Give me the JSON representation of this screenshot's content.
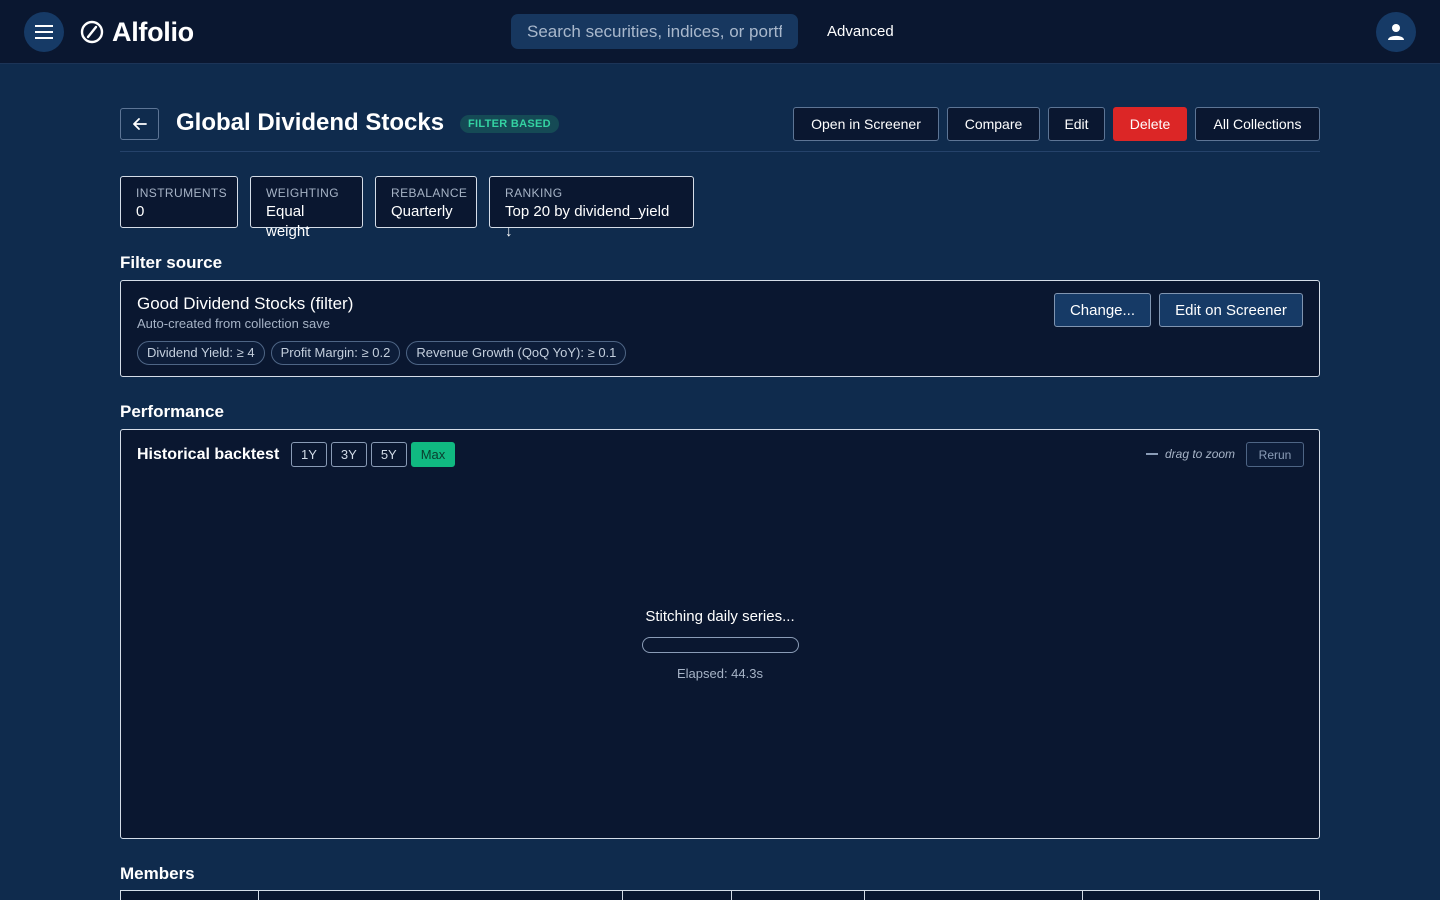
{
  "topbar": {
    "brand": "Alfolio",
    "search_placeholder": "Search securities, indices, or portfolios",
    "advanced_label": "Advanced",
    "icons": [
      "menu-icon",
      "compass-icon",
      "user-icon"
    ]
  },
  "header": {
    "title": "Global Dividend Stocks",
    "type_badge": "FILTER BASED",
    "buttons": {
      "open_in_screener": "Open in Screener",
      "compare": "Compare",
      "edit": "Edit",
      "delete": "Delete",
      "all_collections": "All Collections"
    }
  },
  "stats": [
    {
      "label": "INSTRUMENTS",
      "value": "0"
    },
    {
      "label": "WEIGHTING",
      "value": "Equal weight"
    },
    {
      "label": "REBALANCE",
      "value": "Quarterly"
    },
    {
      "label": "RANKING",
      "value": "Top 20 by dividend_yield ↓"
    }
  ],
  "filter_source": {
    "section_title": "Filter source",
    "name": "Good Dividend Stocks (filter)",
    "subtitle": "Auto-created from collection save",
    "chips": [
      "Dividend Yield: ≥ 4",
      "Profit Margin: ≥ 0.2",
      "Revenue Growth (QoQ YoY): ≥ 0.1"
    ],
    "change_button": "Change...",
    "edit_button": "Edit on Screener"
  },
  "performance": {
    "section_title": "Performance",
    "panel_title": "Historical backtest",
    "ranges": [
      "1Y",
      "3Y",
      "5Y",
      "Max"
    ],
    "active_range": "Max",
    "zoom_hint": "drag to zoom",
    "rerun_label": "Rerun",
    "loading_text": "Stitching daily series...",
    "progress_fraction": 0.0,
    "elapsed_text": "Elapsed: 44.3s"
  },
  "members": {
    "section_title": "Members"
  },
  "colors": {
    "background": "#0f2b4d",
    "topbar": "#0a1730",
    "panel": "#0a1730",
    "accent": "#10b981",
    "danger": "#dc2626"
  }
}
